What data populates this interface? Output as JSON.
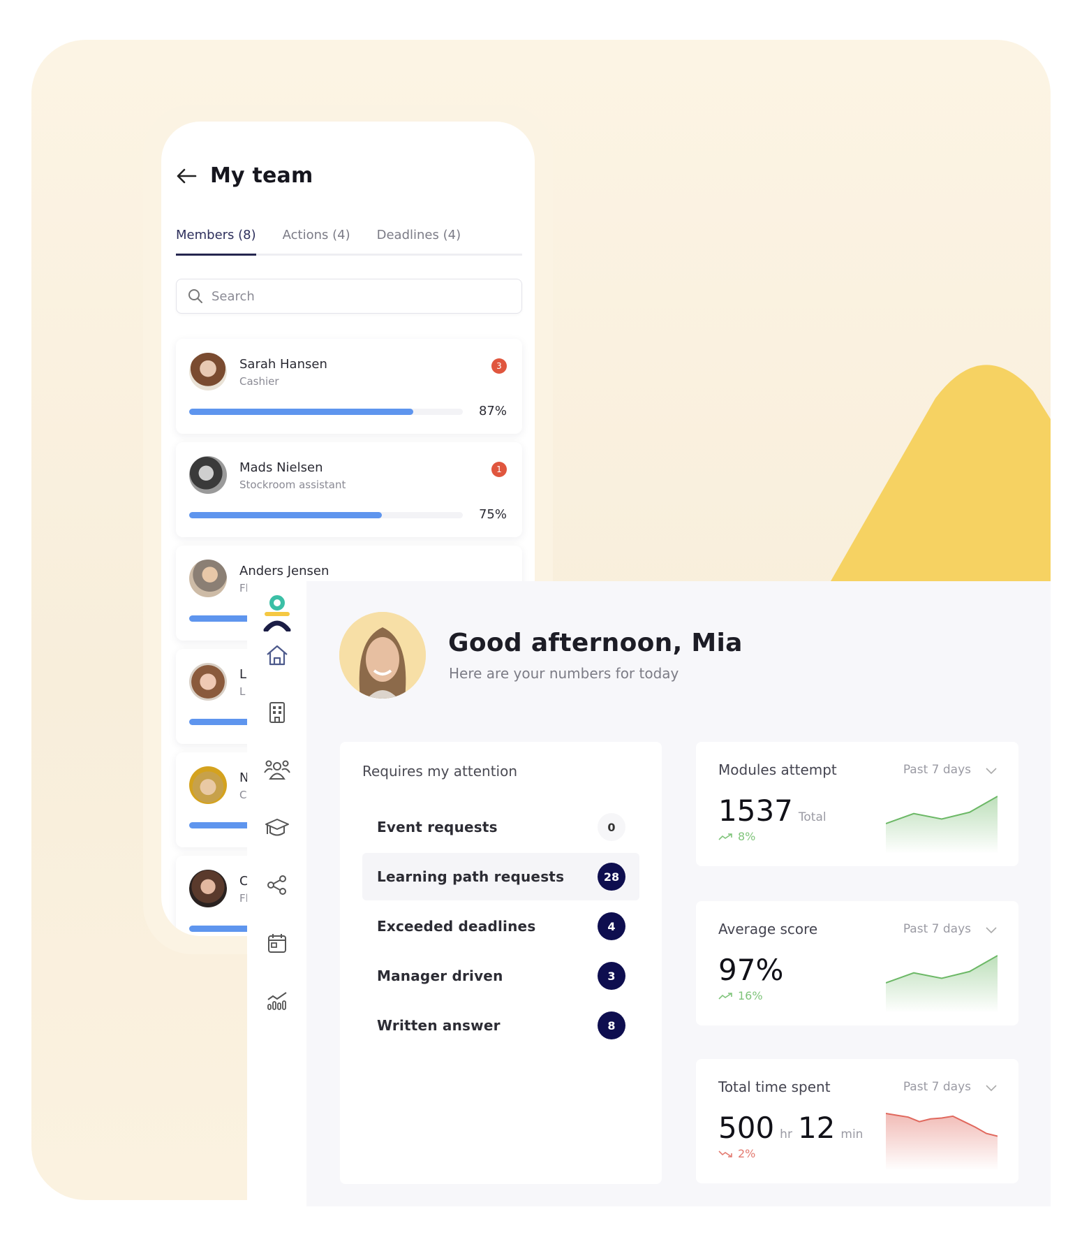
{
  "mobile": {
    "title": "My team",
    "tabs": [
      {
        "label": "Members (8)",
        "active": true
      },
      {
        "label": "Actions (4)",
        "active": false
      },
      {
        "label": "Deadlines (4)",
        "active": false
      }
    ],
    "search": {
      "placeholder": "Search",
      "value": ""
    },
    "members": [
      {
        "name": "Sarah Hansen",
        "role": "Cashier",
        "badge": "3",
        "progress": 87,
        "progress_label": "87%"
      },
      {
        "name": "Mads Nielsen",
        "role": "Stockroom assistant",
        "badge": "1",
        "progress": 75,
        "progress_label": "75%"
      },
      {
        "name": "Anders Jensen",
        "role": "Floor Associate"
      },
      {
        "name": "L",
        "role": "L"
      },
      {
        "name": "N",
        "role": "C"
      },
      {
        "name": "C",
        "role": "Fl"
      }
    ]
  },
  "sidebar": {
    "items": [
      {
        "icon": "home-icon",
        "label": "Home"
      },
      {
        "icon": "building-icon",
        "label": "Organization"
      },
      {
        "icon": "users-icon",
        "label": "Team"
      },
      {
        "icon": "graduation-cap-icon",
        "label": "Learning"
      },
      {
        "icon": "share-icon",
        "label": "Share"
      },
      {
        "icon": "calendar-icon",
        "label": "Calendar"
      },
      {
        "icon": "analytics-icon",
        "label": "Analytics"
      }
    ]
  },
  "dashboard": {
    "greeting": "Good afternoon, Mia",
    "subtitle": "Here are your numbers for today",
    "attention": {
      "title": "Requires my attention",
      "items": [
        {
          "label": "Event requests",
          "count": "0"
        },
        {
          "label": "Learning path requests",
          "count": "28"
        },
        {
          "label": "Exceeded deadlines",
          "count": "4"
        },
        {
          "label": "Manager driven",
          "count": "3"
        },
        {
          "label": "Written answer",
          "count": "8"
        }
      ]
    },
    "stats": [
      {
        "title": "Modules attempt",
        "period": "Past 7 days",
        "value": "1537",
        "unit": "Total",
        "delta": "8%",
        "trend": "up",
        "spark": [
          20,
          42,
          30,
          45,
          80
        ]
      },
      {
        "title": "Average score",
        "period": "Past 7 days",
        "value": "97%",
        "unit": "",
        "delta": "16%",
        "trend": "up",
        "spark": [
          20,
          42,
          30,
          45,
          80
        ]
      },
      {
        "title": "Total time spent",
        "period": "Past 7 days",
        "value": "500",
        "unit": "hr",
        "value2": "12",
        "unit2": "min",
        "delta": "2%",
        "trend": "down",
        "spark": [
          80,
          76,
          72,
          62,
          68,
          70,
          74,
          62,
          50,
          36,
          30
        ]
      }
    ]
  },
  "colors": {
    "accent_navy": "#0e0e4f",
    "progress_blue": "#5e95ee",
    "badge_red": "#e0563e",
    "trend_up": "#6cb866",
    "trend_down": "#e0685d",
    "mountain_yellow": "#f6d262"
  }
}
